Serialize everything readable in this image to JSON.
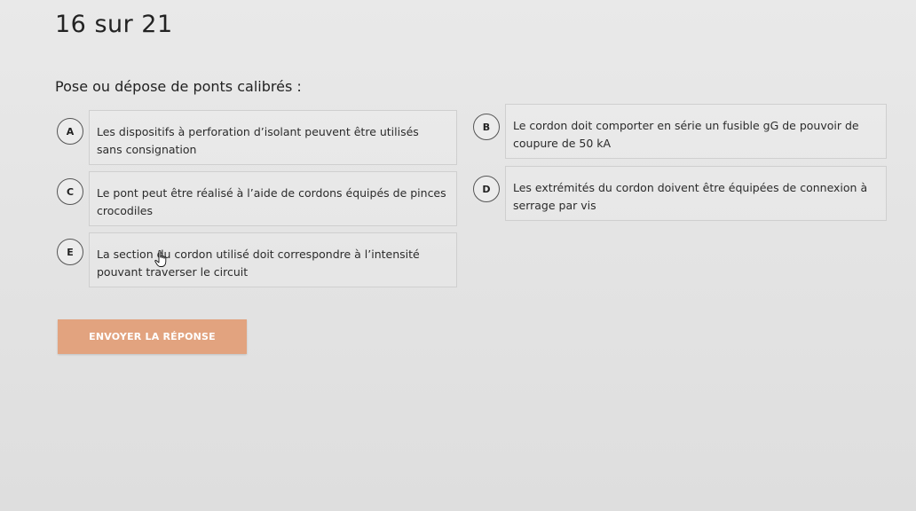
{
  "progress": {
    "label": "16 sur 21"
  },
  "question": {
    "title": "Pose ou dépose de ponts calibrés :"
  },
  "options": [
    {
      "letter": "A",
      "text": "Les dispositifs à perforation d’isolant peuvent être utilisés sans consignation"
    },
    {
      "letter": "B",
      "text": "Le cordon doit comporter en série un fusible gG de pouvoir de coupure de 50 kA"
    },
    {
      "letter": "C",
      "text": "Le pont peut être réalisé à l’aide de cordons équipés de pinces crocodiles"
    },
    {
      "letter": "D",
      "text": "Les extrémités du cordon doivent être équipées de connexion à serrage par vis"
    },
    {
      "letter": "E",
      "text": "La section du cordon utilisé doit correspondre à l’intensité pouvant traverser le circuit"
    }
  ],
  "submit": {
    "label": "ENVOYER LA RÉPONSE"
  },
  "colors": {
    "submit_bg": "#e2a37f",
    "background": "#e6e6e6"
  },
  "icons": {
    "cursor": "hand-pointer-icon"
  }
}
